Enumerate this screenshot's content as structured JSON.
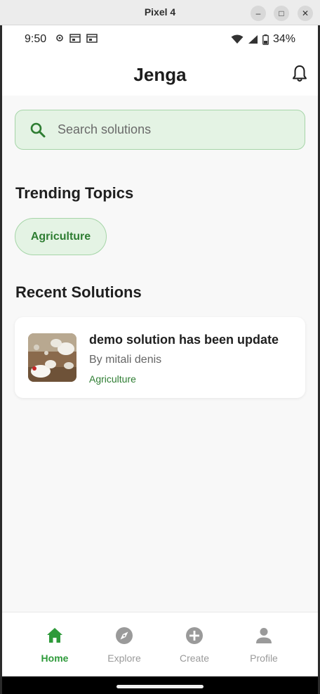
{
  "window": {
    "title": "Pixel 4",
    "buttons": {
      "minimize": "–",
      "maximize": "□",
      "close": "✕"
    }
  },
  "status_bar": {
    "time": "9:50",
    "battery": "34%"
  },
  "app": {
    "title": "Jenga",
    "notification_icon": "bell-icon"
  },
  "search": {
    "placeholder": "Search solutions",
    "value": "",
    "icon": "search-icon"
  },
  "trending": {
    "heading": "Trending Topics",
    "topics": [
      "Agriculture"
    ]
  },
  "recent": {
    "heading": "Recent Solutions",
    "items": [
      {
        "title": "demo solution has been update",
        "author": "By mitali denis",
        "category": "Agriculture"
      }
    ]
  },
  "bottom_nav": {
    "items": [
      {
        "label": "Home",
        "icon": "home-icon",
        "active": true
      },
      {
        "label": "Explore",
        "icon": "compass-icon",
        "active": false
      },
      {
        "label": "Create",
        "icon": "add-circle-icon",
        "active": false
      },
      {
        "label": "Profile",
        "icon": "person-icon",
        "active": false
      }
    ]
  },
  "colors": {
    "accent_green": "#2e7d32",
    "chip_bg": "#e4f3e4",
    "chip_border": "#a6d5a8",
    "nav_active": "#2e9a3a",
    "nav_inactive": "#9a9a9a"
  }
}
